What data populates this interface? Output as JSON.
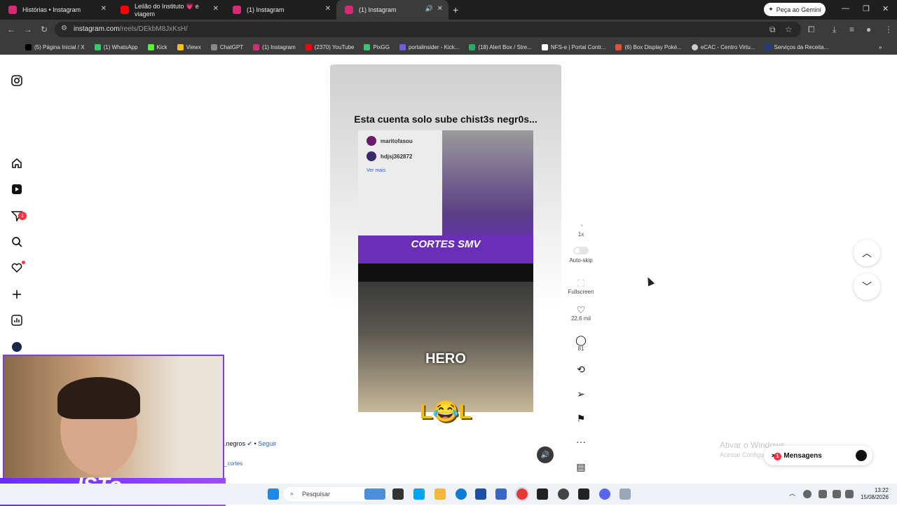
{
  "browser": {
    "tabs": [
      {
        "label": "Histórias • Instagram",
        "color": "#d62976"
      },
      {
        "label": "Leilão do Instituto 💗 e viagem",
        "color": "#ff0000"
      },
      {
        "label": "(1) Instagram",
        "color": "#d62976"
      },
      {
        "label": "(1) Instagram",
        "color": "#d62976",
        "active": true
      }
    ],
    "gemini_label": "Peça ao Gemini",
    "url_host": "instagram.com",
    "url_path": "/reels/DEkbM8JxKsH/",
    "bookmarks": [
      {
        "label": "(5) Página Inicial / X",
        "color": "#000000"
      },
      {
        "label": "(1) WhatsApp",
        "color": "#25d366"
      },
      {
        "label": "Kick",
        "color": "#53fc18"
      },
      {
        "label": "Viewx",
        "color": "#f5c400"
      },
      {
        "label": "ChatGPT",
        "color": "#888888"
      },
      {
        "label": "(1) Instagram",
        "color": "#d62976"
      },
      {
        "label": "(2370) YouTube",
        "color": "#ff0000"
      },
      {
        "label": "PixGG",
        "color": "#2ecc71"
      },
      {
        "label": "portalinsider - Kick...",
        "color": "#6c5ce7"
      },
      {
        "label": "(18) Alert Box / Stre...",
        "color": "#27ae60"
      },
      {
        "label": "NFS-e | Portal Contr...",
        "color": "#ffffff"
      },
      {
        "label": "(6) Box Display Poké...",
        "color": "#e74c3c"
      },
      {
        "label": "eCAC - Centro Virtu...",
        "color": "#cccccc"
      },
      {
        "label": "Serviços da Receita...",
        "color": "#1e3a8a"
      }
    ]
  },
  "reel": {
    "title": "Esta cuenta solo sube chist3s negr0s...",
    "card_user1": "maritofasou",
    "card_user2": "hdjsj362872",
    "ver_mais": "Ver mais",
    "overlay_cortes": "CORTES SMV",
    "overlay_hero": "HERO",
    "overlay_lol": "L😂L"
  },
  "actions": {
    "speed": "1x",
    "autoskip": "Auto-skip",
    "fullscreen": "Fullscreen",
    "likes": "22,6 mil",
    "comments": "81"
  },
  "creator": {
    "name": ".negros",
    "dot": "•",
    "follow": "Seguir",
    "sub": "_cortes"
  },
  "sidebar": {
    "notifications_badge": "1"
  },
  "windows": {
    "activate_title": "Ativar o Windows",
    "activate_sub": "Acesse Configurações",
    "messages_label": "Mensagens",
    "messages_badge": "1",
    "search_placeholder": "Pesquisar",
    "time": "13:22",
    "date": "15/08/2026"
  },
  "stream": {
    "banner_text": "ISTo"
  }
}
